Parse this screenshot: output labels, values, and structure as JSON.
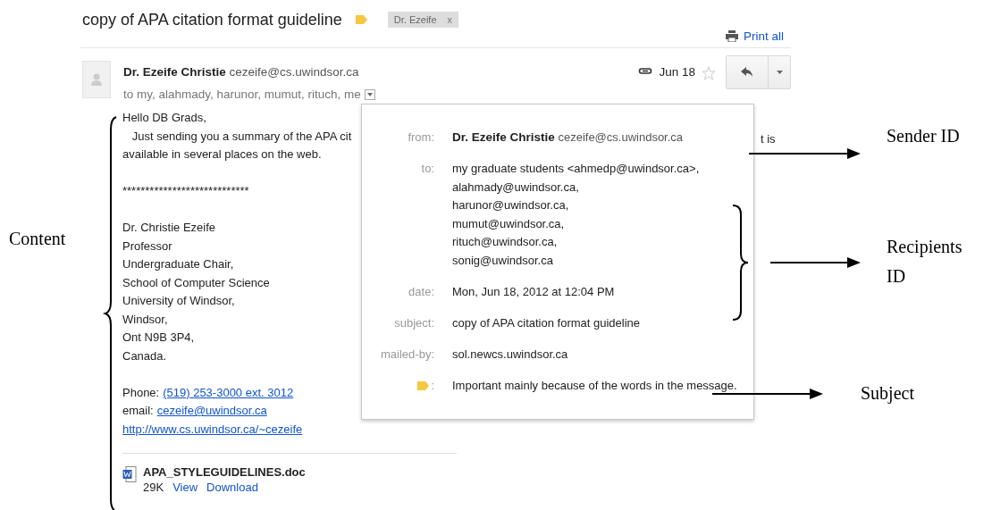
{
  "thread": {
    "subject": "copy of APA citation format guideline",
    "label_chip": "Dr. Ezeife",
    "chip_close": "x",
    "print_all": "Print all"
  },
  "message": {
    "sender_name": "Dr. Ezeife Christie",
    "sender_email": "cezeife@cs.uwindsor.ca",
    "recipients": "to my, alahmady, harunor, mumut, rituch, me",
    "date": "Jun 18",
    "starred": false,
    "body": [
      [
        {
          "text": "Hello DB Grads,"
        },
        {
          "text": "   Just sending you a summary of the APA cit",
          "covered_tail": "t is"
        },
        {
          "text": "available in several places on the web."
        }
      ],
      [
        {
          "text": "****************************"
        }
      ],
      [
        {
          "text": "Dr. Christie Ezeife"
        },
        {
          "text": "Professor"
        },
        {
          "text": "Undergraduate Chair,"
        },
        {
          "text": "School of Computer Science"
        },
        {
          "text": "University of Windsor,"
        },
        {
          "text": "Windsor,"
        },
        {
          "text": "Ont N9B 3P4,"
        },
        {
          "text": "Canada."
        }
      ],
      [
        {
          "label": "Phone:",
          "link": "(519) 253-3000 ext. 3012"
        },
        {
          "label": "email:",
          "link": "cezeife@uwindsor.ca"
        },
        {
          "link": "http://www.cs.uwindsor.ca/~cezeife"
        }
      ]
    ],
    "attachment": {
      "name": "APA_STYLEGUIDELINES.doc",
      "size": "29K",
      "actions": [
        "View",
        "Download"
      ]
    }
  },
  "details_popup": {
    "rows": [
      {
        "kind": "sender",
        "label": "from:",
        "name": "Dr. Ezeife Christie",
        "value": "cezeife@cs.uwindsor.ca"
      },
      {
        "kind": "list",
        "label": "to:",
        "lines": [
          "my graduate students <ahmedp@uwindsor.ca>,",
          "alahmady@uwindsor.ca,",
          "harunor@uwindsor.ca,",
          "mumut@uwindsor.ca,",
          "rituch@uwindsor.ca,",
          "sonig@uwindsor.ca"
        ]
      },
      {
        "kind": "text",
        "label": "date:",
        "value": "Mon, Jun 18, 2012 at 12:04 PM"
      },
      {
        "kind": "text",
        "label": "subject:",
        "value": "copy of APA citation format guideline"
      },
      {
        "kind": "text",
        "label": "mailed-by:",
        "value": "sol.newcs.uwindsor.ca"
      },
      {
        "kind": "importance",
        "label": ":",
        "value": "Important mainly because of the words in the message."
      }
    ]
  },
  "annotations": [
    {
      "text": "Sender ID"
    },
    {
      "text": "Recipients ID"
    },
    {
      "text": "Subject"
    },
    {
      "text": "Content"
    }
  ]
}
